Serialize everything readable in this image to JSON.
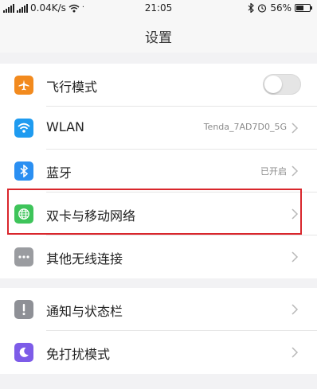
{
  "status_bar": {
    "network_speed": "0.04K/s",
    "time": "21:05",
    "battery_percent": "56%",
    "battery_level": 0.56,
    "icons": [
      "signal-icon",
      "wifi-icon",
      "bluetooth-icon",
      "alarm-icon",
      "battery-icon"
    ]
  },
  "header": {
    "title": "设置"
  },
  "groups": [
    {
      "items": [
        {
          "label": "飞行模式",
          "icon": "airplane-icon",
          "icon_color": "#f28a1e",
          "toggle": "off"
        },
        {
          "label": "WLAN",
          "icon": "wifi-icon",
          "icon_color": "#1e9bf0",
          "value": "Tenda_7AD7D0_5G"
        },
        {
          "label": "蓝牙",
          "icon": "bluetooth-icon",
          "icon_color": "#2a8ff2",
          "value": "已开启"
        },
        {
          "label": "双卡与移动网络",
          "icon": "globe-icon",
          "icon_color": "#3ec45a"
        },
        {
          "label": "其他无线连接",
          "icon": "more-icon",
          "icon_color": "#9a9ca0"
        }
      ]
    },
    {
      "items": [
        {
          "label": "通知与状态栏",
          "icon": "notification-icon",
          "icon_color": "#8e9096"
        },
        {
          "label": "免打扰模式",
          "icon": "moon-icon",
          "icon_color": "#7d5ce8"
        }
      ]
    }
  ],
  "highlight_color": "#d9262c"
}
